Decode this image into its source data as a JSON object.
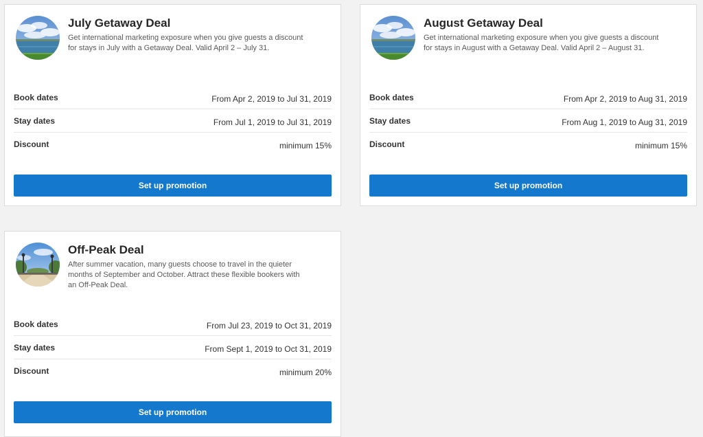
{
  "deals": [
    {
      "title": "July Getaway Deal",
      "description": "Get international marketing exposure when you give guests a discount for stays in July with a Getaway Deal. Valid April 2 – July 31.",
      "image": "lake-sky-image",
      "rows": [
        {
          "label": "Book dates",
          "value": "From Apr 2, 2019 to Jul 31, 2019"
        },
        {
          "label": "Stay dates",
          "value": "From Jul 1, 2019 to Jul 31, 2019"
        },
        {
          "label": "Discount",
          "value": "minimum 15%"
        }
      ],
      "button_label": "Set up promotion"
    },
    {
      "title": "August Getaway Deal",
      "description": "Get international marketing exposure when you give guests a discount for stays in August with a Getaway Deal. Valid April 2 – August 31.",
      "image": "lake-sky-image",
      "rows": [
        {
          "label": "Book dates",
          "value": "From Apr 2, 2019 to Aug 31, 2019"
        },
        {
          "label": "Stay dates",
          "value": "From Aug 1, 2019 to Aug 31, 2019"
        },
        {
          "label": "Discount",
          "value": "minimum 15%"
        }
      ],
      "button_label": "Set up promotion"
    },
    {
      "title": "Off-Peak Deal",
      "description": "After summer vacation, many guests choose to travel in the quieter months of September and October. Attract these flexible bookers with an Off-Peak Deal.",
      "image": "park-lamps-image",
      "rows": [
        {
          "label": "Book dates",
          "value": "From Jul 23, 2019 to Oct 31, 2019"
        },
        {
          "label": "Stay dates",
          "value": "From Sept 1, 2019 to Oct 31, 2019"
        },
        {
          "label": "Discount",
          "value": "minimum 20%"
        }
      ],
      "button_label": "Set up promotion"
    }
  ],
  "colors": {
    "page_background": "#f2f2f2",
    "card_background": "#ffffff",
    "button": "#1479cc",
    "button_text": "#ffffff",
    "title_text": "#262626"
  }
}
